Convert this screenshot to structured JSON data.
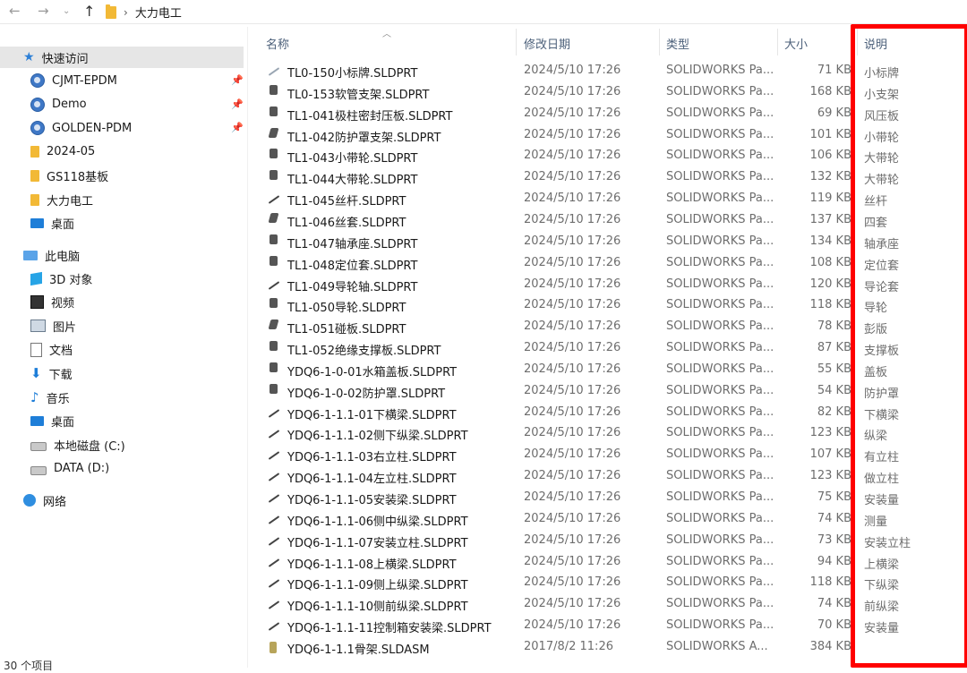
{
  "address": {
    "path": "大力电工"
  },
  "nav": {
    "quick_access": "快速访问",
    "items": [
      {
        "label": "CJMT-EPDM",
        "icon": "pdm-icon",
        "pinned": true
      },
      {
        "label": "Demo",
        "icon": "pdm-icon",
        "pinned": true
      },
      {
        "label": "GOLDEN-PDM",
        "icon": "pdm-icon",
        "pinned": true
      },
      {
        "label": "2024-05",
        "icon": "folder-icon",
        "pinned": false
      },
      {
        "label": "GS118基板",
        "icon": "folder-icon",
        "pinned": false
      },
      {
        "label": "大力电工",
        "icon": "folder-icon",
        "pinned": false
      },
      {
        "label": "桌面",
        "icon": "desktop-icon",
        "pinned": false
      }
    ],
    "this_pc": "此电脑",
    "pc_items": [
      {
        "label": "3D 对象",
        "icon": "cube-icon"
      },
      {
        "label": "视频",
        "icon": "video-icon"
      },
      {
        "label": "图片",
        "icon": "picture-icon"
      },
      {
        "label": "文档",
        "icon": "document-icon"
      },
      {
        "label": "下载",
        "icon": "download-icon"
      },
      {
        "label": "音乐",
        "icon": "music-icon"
      },
      {
        "label": "桌面",
        "icon": "desktop-icon"
      },
      {
        "label": "本地磁盘 (C:)",
        "icon": "drive-icon"
      },
      {
        "label": "DATA (D:)",
        "icon": "drive-icon"
      }
    ],
    "network": "网络"
  },
  "columns": {
    "name": "名称",
    "date": "修改日期",
    "type": "类型",
    "size": "大小",
    "desc": "说明"
  },
  "files": [
    {
      "name": "TL0-150小标牌.SLDPRT",
      "date": "2024/5/10 17:26",
      "type": "SOLIDWORKS Pa...",
      "size": "71 KB",
      "desc": "小标牌"
    },
    {
      "name": "TL0-153软管支架.SLDPRT",
      "date": "2024/5/10 17:26",
      "type": "SOLIDWORKS Pa...",
      "size": "168 KB",
      "desc": "小支架"
    },
    {
      "name": "TL1-041极柱密封压板.SLDPRT",
      "date": "2024/5/10 17:26",
      "type": "SOLIDWORKS Pa...",
      "size": "69 KB",
      "desc": "风压板"
    },
    {
      "name": "TL1-042防护罩支架.SLDPRT",
      "date": "2024/5/10 17:26",
      "type": "SOLIDWORKS Pa...",
      "size": "101 KB",
      "desc": "小带轮"
    },
    {
      "name": "TL1-043小带轮.SLDPRT",
      "date": "2024/5/10 17:26",
      "type": "SOLIDWORKS Pa...",
      "size": "106 KB",
      "desc": "大带轮"
    },
    {
      "name": "TL1-044大带轮.SLDPRT",
      "date": "2024/5/10 17:26",
      "type": "SOLIDWORKS Pa...",
      "size": "132 KB",
      "desc": "大带轮"
    },
    {
      "name": "TL1-045丝杆.SLDPRT",
      "date": "2024/5/10 17:26",
      "type": "SOLIDWORKS Pa...",
      "size": "119 KB",
      "desc": "丝杆"
    },
    {
      "name": "TL1-046丝套.SLDPRT",
      "date": "2024/5/10 17:26",
      "type": "SOLIDWORKS Pa...",
      "size": "137 KB",
      "desc": "四套"
    },
    {
      "name": "TL1-047轴承座.SLDPRT",
      "date": "2024/5/10 17:26",
      "type": "SOLIDWORKS Pa...",
      "size": "134 KB",
      "desc": "轴承座"
    },
    {
      "name": "TL1-048定位套.SLDPRT",
      "date": "2024/5/10 17:26",
      "type": "SOLIDWORKS Pa...",
      "size": "108 KB",
      "desc": "定位套"
    },
    {
      "name": "TL1-049导轮轴.SLDPRT",
      "date": "2024/5/10 17:26",
      "type": "SOLIDWORKS Pa...",
      "size": "120 KB",
      "desc": "导论套"
    },
    {
      "name": "TL1-050导轮.SLDPRT",
      "date": "2024/5/10 17:26",
      "type": "SOLIDWORKS Pa...",
      "size": "118 KB",
      "desc": "导轮"
    },
    {
      "name": "TL1-051碰板.SLDPRT",
      "date": "2024/5/10 17:26",
      "type": "SOLIDWORKS Pa...",
      "size": "78 KB",
      "desc": "彭版"
    },
    {
      "name": "TL1-052绝缘支撑板.SLDPRT",
      "date": "2024/5/10 17:26",
      "type": "SOLIDWORKS Pa...",
      "size": "87 KB",
      "desc": "支撑板"
    },
    {
      "name": "YDQ6-1-0-01水箱盖板.SLDPRT",
      "date": "2024/5/10 17:26",
      "type": "SOLIDWORKS Pa...",
      "size": "55 KB",
      "desc": "盖板"
    },
    {
      "name": "YDQ6-1-0-02防护罩.SLDPRT",
      "date": "2024/5/10 17:26",
      "type": "SOLIDWORKS Pa...",
      "size": "54 KB",
      "desc": "防护罩"
    },
    {
      "name": "YDQ6-1-1.1-01下横梁.SLDPRT",
      "date": "2024/5/10 17:26",
      "type": "SOLIDWORKS Pa...",
      "size": "82 KB",
      "desc": "下横梁"
    },
    {
      "name": "YDQ6-1-1.1-02侧下纵梁.SLDPRT",
      "date": "2024/5/10 17:26",
      "type": "SOLIDWORKS Pa...",
      "size": "123 KB",
      "desc": "纵梁"
    },
    {
      "name": "YDQ6-1-1.1-03右立柱.SLDPRT",
      "date": "2024/5/10 17:26",
      "type": "SOLIDWORKS Pa...",
      "size": "107 KB",
      "desc": "有立柱"
    },
    {
      "name": "YDQ6-1-1.1-04左立柱.SLDPRT",
      "date": "2024/5/10 17:26",
      "type": "SOLIDWORKS Pa...",
      "size": "123 KB",
      "desc": "做立柱"
    },
    {
      "name": "YDQ6-1-1.1-05安装梁.SLDPRT",
      "date": "2024/5/10 17:26",
      "type": "SOLIDWORKS Pa...",
      "size": "75 KB",
      "desc": "安装量"
    },
    {
      "name": "YDQ6-1-1.1-06侧中纵梁.SLDPRT",
      "date": "2024/5/10 17:26",
      "type": "SOLIDWORKS Pa...",
      "size": "74 KB",
      "desc": "测量"
    },
    {
      "name": "YDQ6-1-1.1-07安装立柱.SLDPRT",
      "date": "2024/5/10 17:26",
      "type": "SOLIDWORKS Pa...",
      "size": "73 KB",
      "desc": "安装立柱"
    },
    {
      "name": "YDQ6-1-1.1-08上横梁.SLDPRT",
      "date": "2024/5/10 17:26",
      "type": "SOLIDWORKS Pa...",
      "size": "94 KB",
      "desc": "上横梁"
    },
    {
      "name": "YDQ6-1-1.1-09侧上纵梁.SLDPRT",
      "date": "2024/5/10 17:26",
      "type": "SOLIDWORKS Pa...",
      "size": "118 KB",
      "desc": "下纵梁"
    },
    {
      "name": "YDQ6-1-1.1-10侧前纵梁.SLDPRT",
      "date": "2024/5/10 17:26",
      "type": "SOLIDWORKS Pa...",
      "size": "74 KB",
      "desc": "前纵梁"
    },
    {
      "name": "YDQ6-1-1.1-11控制箱安装梁.SLDPRT",
      "date": "2024/5/10 17:26",
      "type": "SOLIDWORKS Pa...",
      "size": "70 KB",
      "desc": "安装量"
    },
    {
      "name": "YDQ6-1-1.1骨架.SLDASM",
      "date": "2017/8/2 11:26",
      "type": "SOLIDWORKS A...",
      "size": "384 KB",
      "desc": ""
    }
  ],
  "status": {
    "count": "30 个项目"
  },
  "colors": {
    "highlight": "#ff0000",
    "accent": "#1e7ed8",
    "selected": "#e6e6e6"
  }
}
